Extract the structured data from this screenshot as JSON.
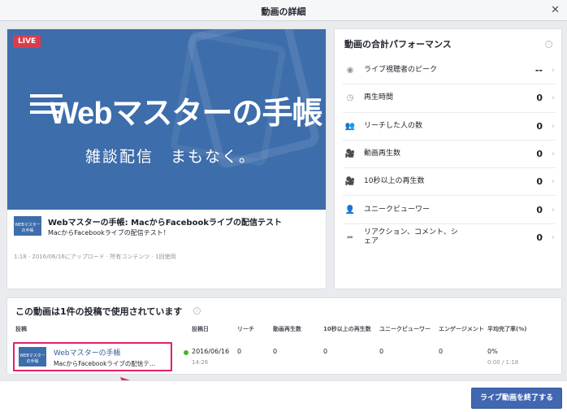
{
  "dialog": {
    "title": "動画の詳細",
    "close_icon": "close-icon"
  },
  "video": {
    "live_badge": "LIVE",
    "logo_text": "Webマスターの手帳",
    "overlay_text": "雑談配信　まもなく。",
    "thumb_mini_text": "WEBマスターの手帳",
    "title": "Webマスターの手帳: MacからFacebookライブの配信テスト",
    "description": "MacからFacebookライブの配信テスト！",
    "meta": "1:18 · 2016/06/16にアップロード · 所有コンテンツ · 1回使用",
    "colors": {
      "thumb_bg": "#3d6dab",
      "live_badge": "#dd3b4b"
    }
  },
  "performance": {
    "title": "動画の合計パフォーマンス",
    "rows": [
      {
        "icon": "eye-icon",
        "label": "ライブ視聴者のピーク",
        "value": "--"
      },
      {
        "icon": "clock-icon",
        "label": "再生時間",
        "value": "0"
      },
      {
        "icon": "people-icon",
        "label": "リーチした人の数",
        "value": "0"
      },
      {
        "icon": "video-camera-icon",
        "label": "動画再生数",
        "value": "0"
      },
      {
        "icon": "video-camera-icon",
        "label": "10秒以上の再生数",
        "value": "0"
      },
      {
        "icon": "person-icon",
        "label": "ユニークビューワー",
        "value": "0"
      },
      {
        "icon": "share-icon",
        "label": "リアクション、コメント、シェア",
        "value": "0"
      }
    ]
  },
  "posts": {
    "title": "この動画は1件の投稿で使用されています",
    "headers": [
      "投稿",
      "投稿日",
      "リーチ",
      "動画再生数",
      "10秒以上の再生数",
      "ユニークビューワー",
      "エンゲージメント",
      "平均完了率(%)"
    ],
    "row": {
      "thumb_text": "WEBマスターの手帳",
      "title": "Webマスターの手帳",
      "description": "MacからFacebookライブの配信テ…",
      "date": "2016/06/16",
      "time": "14:26",
      "reach": "0",
      "views": "0",
      "views_10s": "0",
      "unique_viewers": "0",
      "engagement": "0",
      "avg_completion": "0%",
      "avg_duration": "0:00 / 1:18"
    }
  },
  "footer": {
    "end_button": "ライブ動画を終了する",
    "button_color": "#4267b2"
  },
  "annotation": {
    "highlight_color": "#e2206a"
  }
}
